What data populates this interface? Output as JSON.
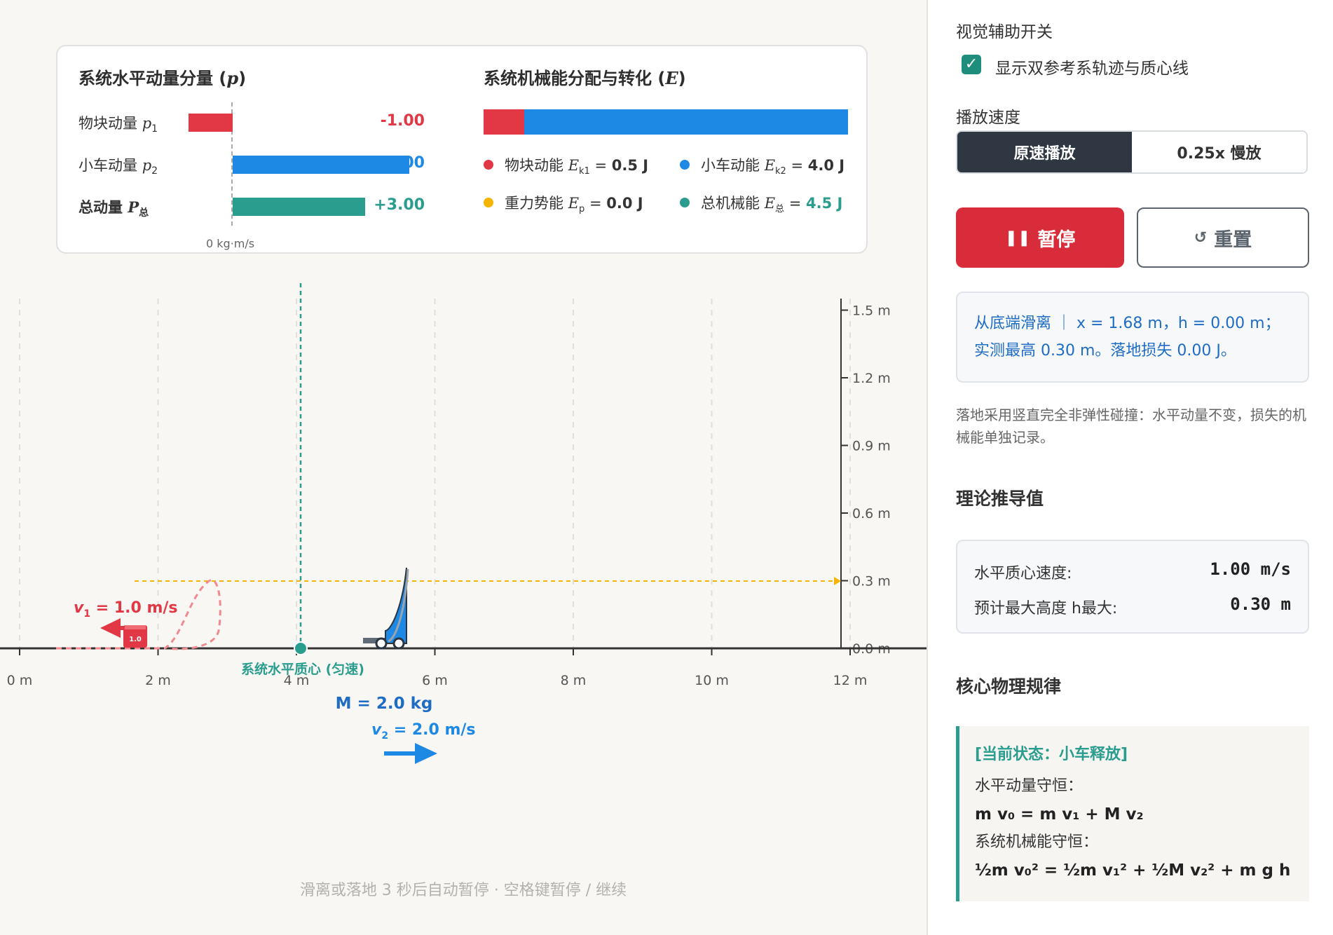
{
  "stats": {
    "momentum_title": "系统水平动量分量 (",
    "momentum_title_sym": "p",
    "momentum_title_end": ")",
    "energy_title": "系统机械能分配与转化 (",
    "energy_title_sym": "E",
    "energy_title_end": ")",
    "rows": [
      {
        "label": "物块动量 ",
        "sym": "p",
        "sub": "1",
        "value": "-1.00",
        "color": "#e23744",
        "momentum": -1.0
      },
      {
        "label": "小车动量 ",
        "sym": "p",
        "sub": "2",
        "value": ".00",
        "color": "#1e88e5",
        "momentum": 4.0
      },
      {
        "label": "总动量 ",
        "sym": "P",
        "sub": "总",
        "value": "+3.00",
        "color": "#2a9d8f",
        "momentum": 3.0
      }
    ],
    "zero_label": "0 kg·m/s",
    "energy": [
      {
        "label": "物块动能 ",
        "sym": "E",
        "sub": "k1",
        "eq": " = ",
        "value": "0.5 J",
        "color": "#e23744",
        "amount": 0.5
      },
      {
        "label": "小车动能 ",
        "sym": "E",
        "sub": "k2",
        "eq": " = ",
        "value": "4.0 J",
        "color": "#1e88e5",
        "amount": 4.0
      },
      {
        "label": "重力势能 ",
        "sym": "E",
        "sub": "p",
        "eq": " = ",
        "value": "0.0 J",
        "color": "#f4b400",
        "amount": 0.0
      },
      {
        "label": "总机械能 ",
        "sym": "E",
        "sub": "总",
        "eq": " = ",
        "value": "4.5 J",
        "color": "#2a9d8f",
        "amount": 4.5
      }
    ]
  },
  "sim": {
    "x_ticks": [
      "0 m",
      "2 m",
      "4 m",
      "6 m",
      "8 m",
      "10 m",
      "12 m"
    ],
    "y_ticks": [
      "0.0 m",
      "0.3 m",
      "0.6 m",
      "0.9 m",
      "1.2 m",
      "1.5 m"
    ],
    "block_label": "1.0",
    "v1_label": "v",
    "v1_sub": "1",
    "v1_value": " = 1.0 m/s",
    "cm_label": "系统水平质心 (匀速)",
    "mass_label": "M = 2.0 kg",
    "v2_label": "v",
    "v2_sub": "2",
    "v2_value": " = 2.0 m/s",
    "hint": "滑离或落地 3 秒后自动暂停 · 空格键暂停 / 继续",
    "colors": {
      "block": "#e23744",
      "cart": "#1e88e5",
      "cm": "#2a9d8f",
      "height_line": "#f4b400"
    }
  },
  "panel": {
    "visual_label": "视觉辅助开关",
    "checkbox_label": "显示双参考系轨迹与质心线",
    "checkbox_checked": true,
    "speed_label": "播放速度",
    "speed_options": [
      "原速播放",
      "0.25x 慢放"
    ],
    "pause_label": "暂停",
    "reset_label": "重置",
    "status_line1": "从底端滑离 ｜ x = 1.68 m，h = 0.00 m；",
    "status_line2": "实测最高 0.30 m。落地损失 0.00 J。",
    "note": "落地采用竖直完全非弹性碰撞：水平动量不变，损失的机械能单独记录。",
    "theory_title": "理论推导值",
    "theory": [
      {
        "label": "水平质心速度:",
        "value": "1.00 m/s"
      },
      {
        "label": "预计最大高度 h最大:",
        "value": "0.30 m"
      }
    ],
    "law_title": "核心物理规律",
    "law_state": "[当前状态：小车释放]",
    "law_momentum_label": "水平动量守恒：",
    "law_momentum_formula": "m v₀ = m v₁ + M v₂",
    "law_energy_label": "系统机械能守恒：",
    "law_energy_formula": "½m v₀² = ½m v₁² + ½M v₂² + m g h"
  }
}
